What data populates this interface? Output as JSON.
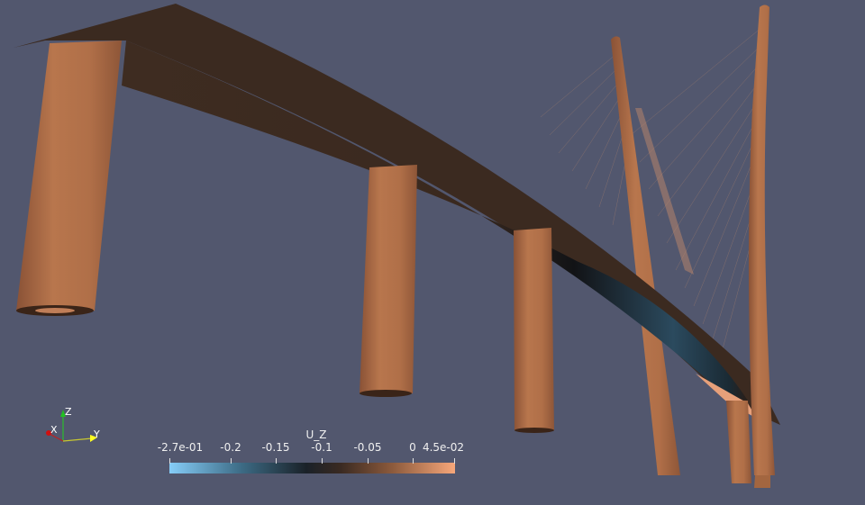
{
  "colorbar": {
    "title": "U_Z",
    "labels": [
      "-2.7e-01",
      "-0.2",
      "-0.15",
      "-0.1",
      "-0.05",
      "0",
      "4.5e-02"
    ],
    "range": [
      -0.27,
      0.045
    ],
    "colors": [
      "#86cdf8",
      "#1a2128",
      "#f7a77a"
    ]
  },
  "axes": {
    "x": "X",
    "y": "Y",
    "z": "Z"
  },
  "colors": {
    "background": "#52576e",
    "structure": "#b2714a"
  }
}
